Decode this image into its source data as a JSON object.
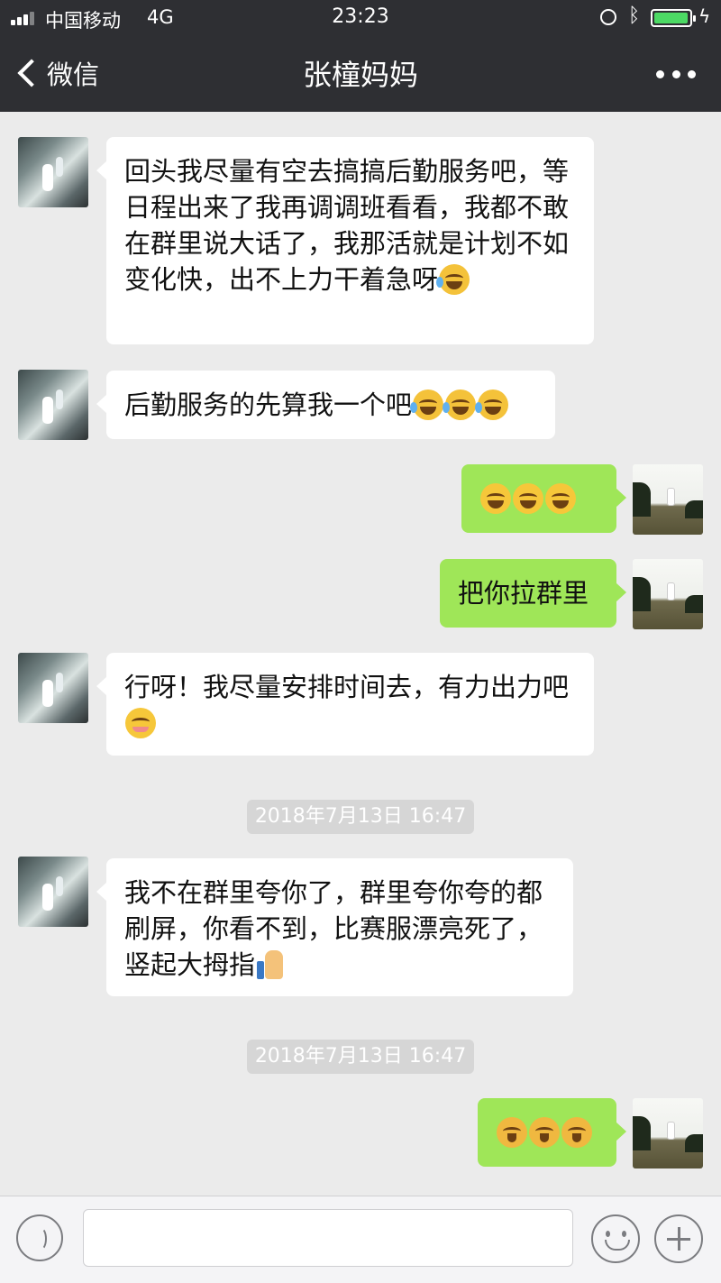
{
  "status_bar": {
    "carrier": "中国移动",
    "network": "4G",
    "time": "23:23"
  },
  "nav": {
    "back_label": "微信",
    "title": "张橦妈妈"
  },
  "messages": [
    {
      "side": "left",
      "text": "回头我尽量有空去搞搞后勤服务吧，等日程出来了我再调调班看看，我都不敢在群里说大话了，我那活就是计划不如变化快，出不上力干着急呀",
      "emoji": [
        "cry-laugh"
      ]
    },
    {
      "side": "left",
      "text": "后勤服务的先算我一个吧",
      "emoji": [
        "cry-laugh",
        "cry-laugh",
        "cry-laugh"
      ]
    },
    {
      "side": "right",
      "text": "",
      "emoji": [
        "tears-of-joy",
        "tears-of-joy",
        "tears-of-joy"
      ]
    },
    {
      "side": "right",
      "text": "把你拉群里",
      "emoji": []
    },
    {
      "side": "left",
      "text": "行呀！我尽量安排时间去，有力出力吧",
      "emoji": [
        "shy-smile"
      ]
    },
    {
      "side": "left",
      "text": "我不在群里夸你了，群里夸你夸的都刷屏，你看不到，比赛服漂亮死了，竖起大拇指",
      "emoji": [
        "thumbs-up"
      ]
    },
    {
      "side": "right",
      "text": "",
      "emoji": [
        "smirk",
        "smirk",
        "smirk"
      ]
    }
  ],
  "timestamps": [
    "2018年7月13日 16:47",
    "2018年7月13日 16:47"
  ],
  "colors": {
    "nav_bg": "#2e2f33",
    "chat_bg": "#ebebeb",
    "sent_bubble": "#9fe658",
    "received_bubble": "#ffffff"
  }
}
